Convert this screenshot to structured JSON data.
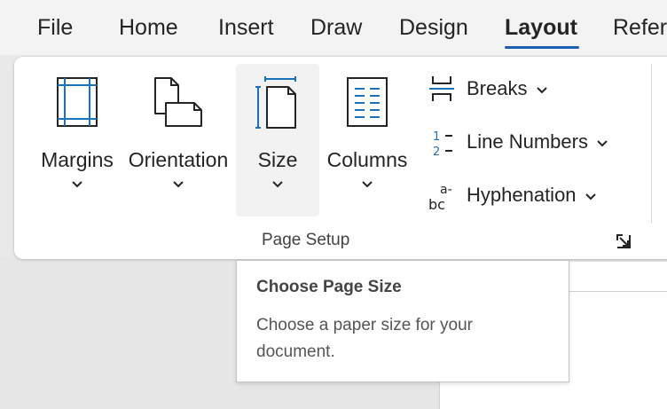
{
  "tabs": [
    {
      "label": "File"
    },
    {
      "label": "Home"
    },
    {
      "label": "Insert"
    },
    {
      "label": "Draw"
    },
    {
      "label": "Design"
    },
    {
      "label": "Layout",
      "active": true
    },
    {
      "label": "Refer"
    }
  ],
  "ribbon": {
    "buttons": {
      "margins": {
        "label": "Margins",
        "icon": "margins-icon"
      },
      "orientation": {
        "label": "Orientation",
        "icon": "orientation-icon"
      },
      "size": {
        "label": "Size",
        "icon": "page-size-icon"
      },
      "columns": {
        "label": "Columns",
        "icon": "columns-icon"
      }
    },
    "small_buttons": {
      "breaks": {
        "label": "Breaks",
        "icon": "breaks-icon"
      },
      "line_numbers": {
        "label": "Line Numbers",
        "icon": "line-numbers-icon"
      },
      "hyphenation": {
        "label": "Hyphenation",
        "icon": "hyphenation-icon"
      }
    },
    "group_label": "Page Setup",
    "accent_color": "#1a73b8"
  },
  "tooltip": {
    "title": "Choose Page Size",
    "body": "Choose a paper size for your document."
  }
}
